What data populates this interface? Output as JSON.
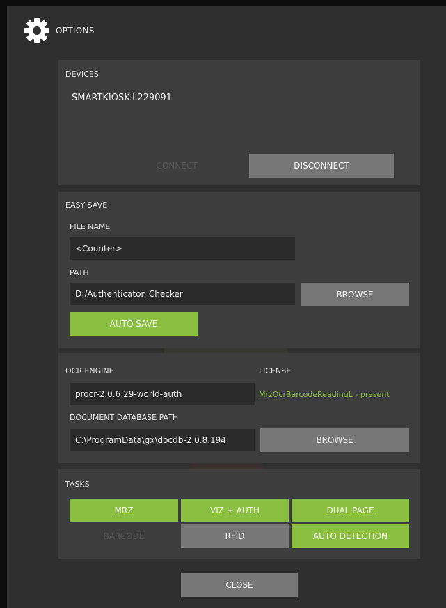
{
  "header": {
    "title": "OPTIONS",
    "icon": "gear-icon"
  },
  "devices": {
    "section_label": "DEVICES",
    "device_name": "SMARTKIOSK-L229091",
    "connect_label": "CONNECT",
    "disconnect_label": "DISCONNECT"
  },
  "easy_save": {
    "section_label": "EASY SAVE",
    "file_name_label": "FILE NAME",
    "file_name_value": "<Counter>",
    "path_label": "PATH",
    "path_value": "D:/Authenticaton Checker",
    "browse_label": "BROWSE",
    "auto_save_label": "AUTO SAVE"
  },
  "ocr": {
    "engine_label": "OCR ENGINE",
    "engine_value": "procr-2.0.6.29-world-auth",
    "license_label": "LICENSE",
    "license_value": "MrzOcrBarcodeReadingL - present",
    "docdb_label": "DOCUMENT DATABASE PATH",
    "docdb_value": "C:\\ProgramData\\gx\\docdb-2.0.8.194",
    "browse_label": "BROWSE"
  },
  "tasks": {
    "section_label": "TASKS",
    "mrz_label": "MRZ",
    "viz_auth_label": "VIZ + AUTH",
    "dual_page_label": "DUAL PAGE",
    "barcode_label": "BARCODE",
    "rfid_label": "RFID",
    "auto_detection_label": "AUTO DETECTION"
  },
  "footer": {
    "close_label": "CLOSE"
  },
  "colors": {
    "accent_green": "#8bbf41",
    "button_gray": "#777777",
    "panel_bg": "#3d3d3d",
    "window_bg": "#2f2f2f",
    "field_bg": "#2b2b2b"
  }
}
